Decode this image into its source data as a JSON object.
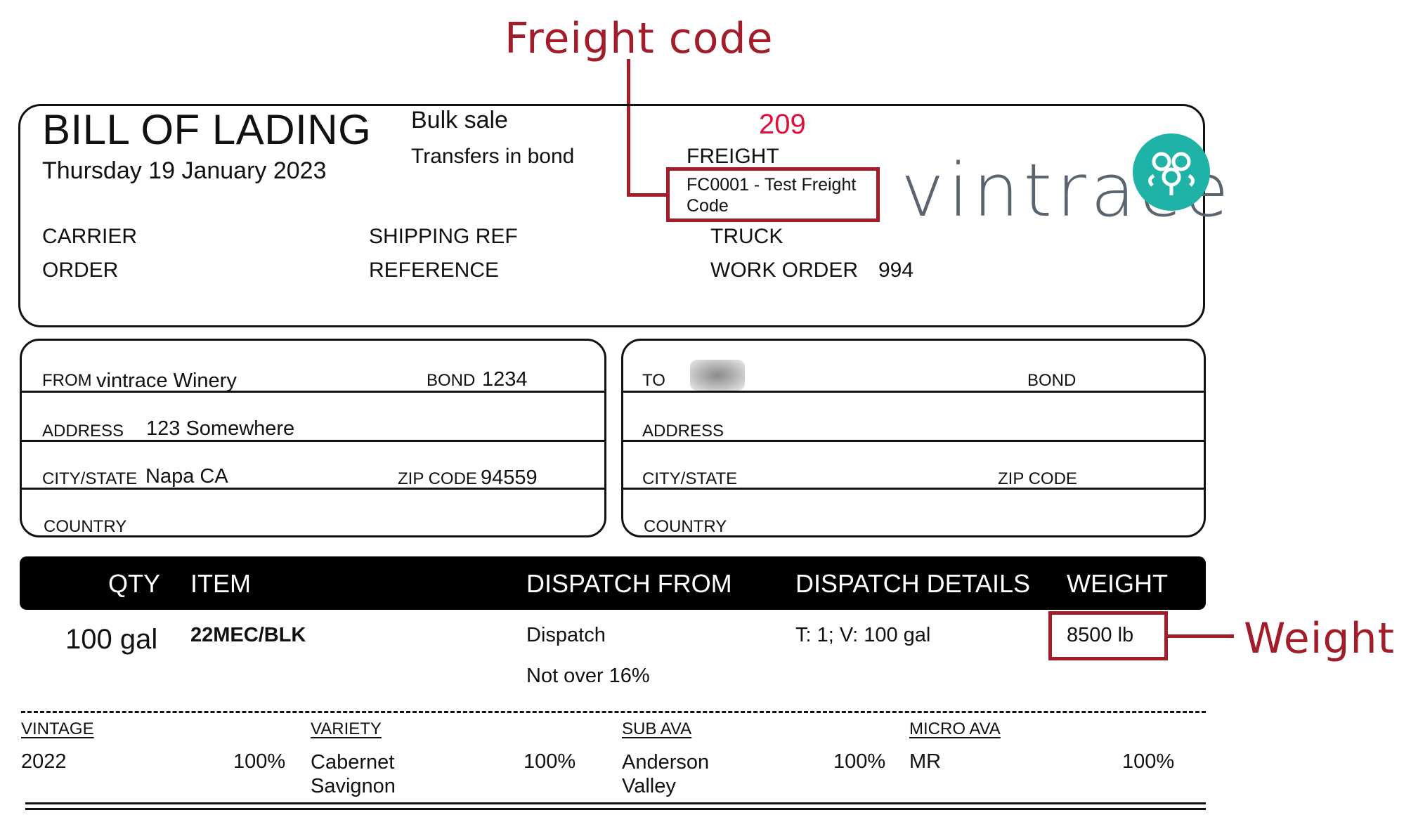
{
  "annotations": {
    "freight_code": "Freight code",
    "weight": "Weight"
  },
  "header": {
    "title": "BILL OF LADING",
    "date": "Thursday 19 January 2023",
    "sale_type": "Bulk sale",
    "transfer_type": "Transfers in bond",
    "number": "209",
    "freight_label": "FREIGHT",
    "freight_value": "FC0001 - Test Freight Code",
    "carrier_label": "CARRIER",
    "order_label": "ORDER",
    "shipping_ref_label": "SHIPPING REF",
    "reference_label": "REFERENCE",
    "truck_label": "TRUCK",
    "work_order_label": "WORK ORDER",
    "work_order_value": "994"
  },
  "logo": {
    "text": "vintrace",
    "icon": "grape-cluster-icon",
    "accent": "#1fb3a8"
  },
  "from": {
    "from_label": "FROM",
    "from_value": "vintrace Winery",
    "bond_label": "BOND",
    "bond_value": "1234",
    "address_label": "ADDRESS",
    "address_value": "123 Somewhere",
    "city_label": "CITY/STATE",
    "city_value": "Napa CA",
    "zip_label": "ZIP CODE",
    "zip_value": "94559",
    "country_label": "COUNTRY"
  },
  "to": {
    "to_label": "TO",
    "bond_label": "BOND",
    "address_label": "ADDRESS",
    "city_label": "CITY/STATE",
    "zip_label": "ZIP CODE",
    "country_label": "COUNTRY"
  },
  "table": {
    "headers": [
      "QTY",
      "ITEM",
      "DISPATCH FROM",
      "DISPATCH DETAILS",
      "WEIGHT"
    ],
    "row": {
      "qty": "100 gal",
      "item": "22MEC/BLK",
      "dispatch_from": "Dispatch",
      "dispatch_note": "Not over 16%",
      "dispatch_details": "T: 1; V: 100 gal",
      "weight": "8500 lb"
    }
  },
  "composition": {
    "vintage_label": "VINTAGE",
    "vintage_value": "2022",
    "vintage_pct": "100%",
    "variety_label": "VARIETY",
    "variety_value": "Cabernet Savignon",
    "variety_pct": "100%",
    "sub_ava_label": "SUB AVA",
    "sub_ava_value": "Anderson Valley",
    "sub_ava_pct": "100%",
    "micro_ava_label": "MICRO AVA",
    "micro_ava_value": "MR",
    "micro_ava_pct": "100%"
  }
}
